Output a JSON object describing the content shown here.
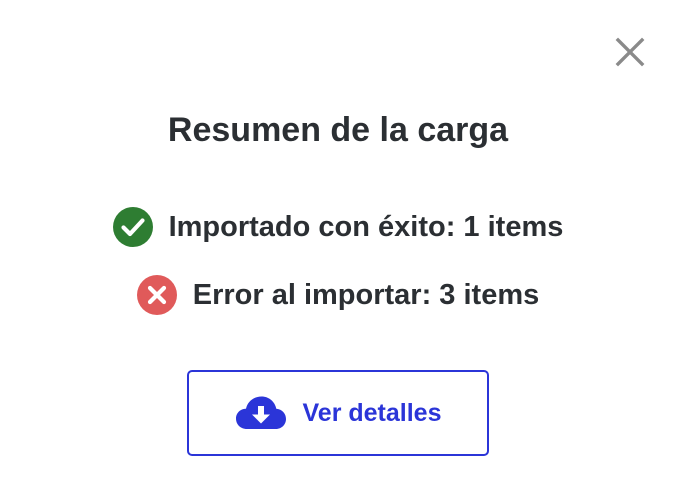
{
  "dialog": {
    "title": "Resumen de la carga",
    "close_icon": "close-icon",
    "results": {
      "success": {
        "icon": "check-circle-icon",
        "color": "#2e7d32",
        "text": "Importado con éxito: 1 items"
      },
      "error": {
        "icon": "error-circle-icon",
        "color": "#e05a5a",
        "text": "Error al importar: 3 items"
      }
    },
    "details_button": {
      "icon": "cloud-download-icon",
      "label": "Ver detalles",
      "color": "#2b35d8"
    }
  }
}
